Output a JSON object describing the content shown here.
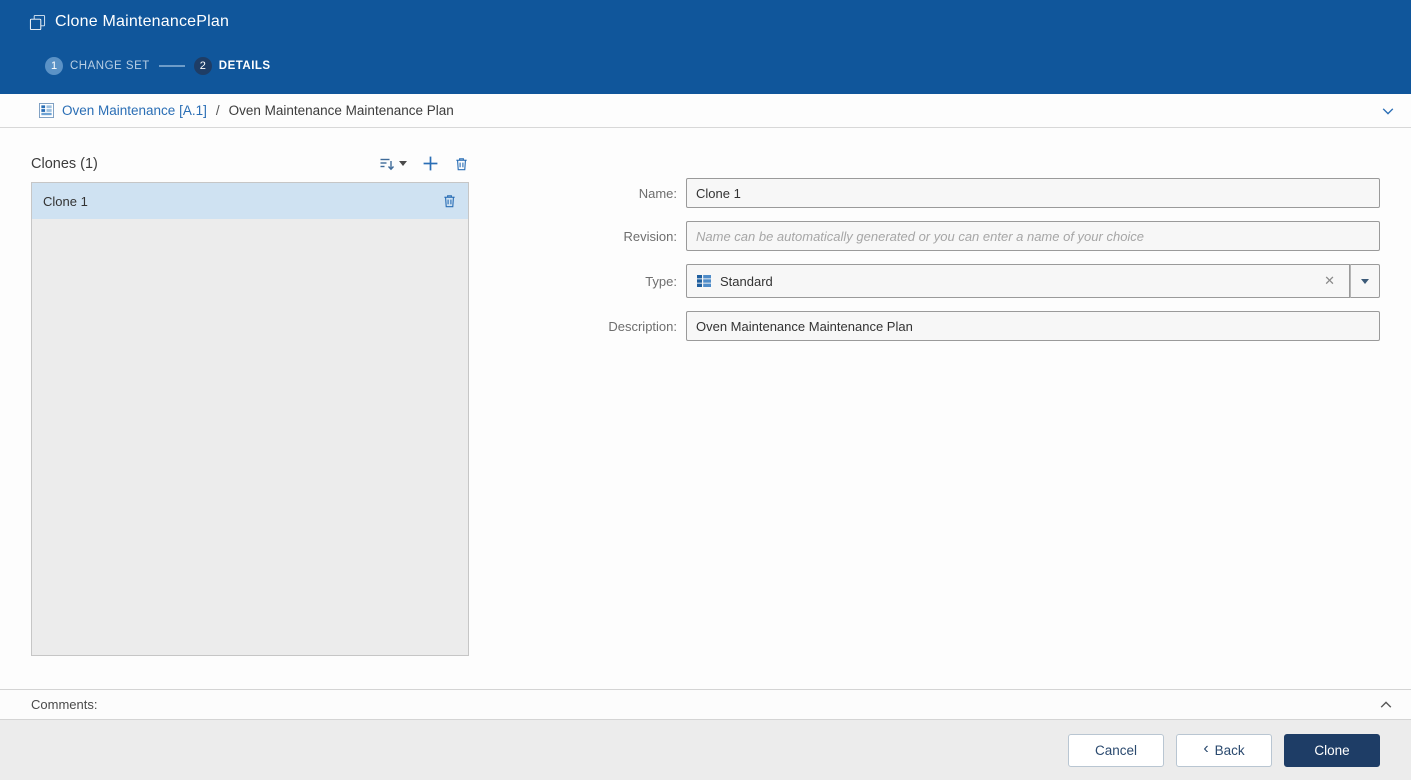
{
  "colors": {
    "header-bg": "#10569b",
    "primary-navy": "#1e3d66",
    "accent-blue": "#2a6eb5",
    "selected-bg": "#cfe2f2"
  },
  "header": {
    "title": "Clone MaintenancePlan",
    "steps": [
      {
        "number": "1",
        "label": "CHANGE SET"
      },
      {
        "number": "2",
        "label": "DETAILS"
      }
    ]
  },
  "breadcrumb": {
    "root": "Oven Maintenance [A.1]",
    "separator": "/",
    "current": "Oven Maintenance Maintenance Plan"
  },
  "clones": {
    "title": "Clones (1)",
    "items": [
      {
        "name": "Clone 1"
      }
    ]
  },
  "form": {
    "name": {
      "label": "Name:",
      "value": "Clone 1"
    },
    "revision": {
      "label": "Revision:",
      "placeholder": "Name can be automatically generated or you can enter a name of your choice"
    },
    "type": {
      "label": "Type:",
      "value": "Standard",
      "clear": "✕"
    },
    "description": {
      "label": "Description:",
      "value": "Oven Maintenance Maintenance Plan"
    }
  },
  "comments": {
    "label": "Comments:"
  },
  "footer": {
    "cancel": "Cancel",
    "back": "Back",
    "back_chevron": "‹",
    "clone": "Clone"
  }
}
